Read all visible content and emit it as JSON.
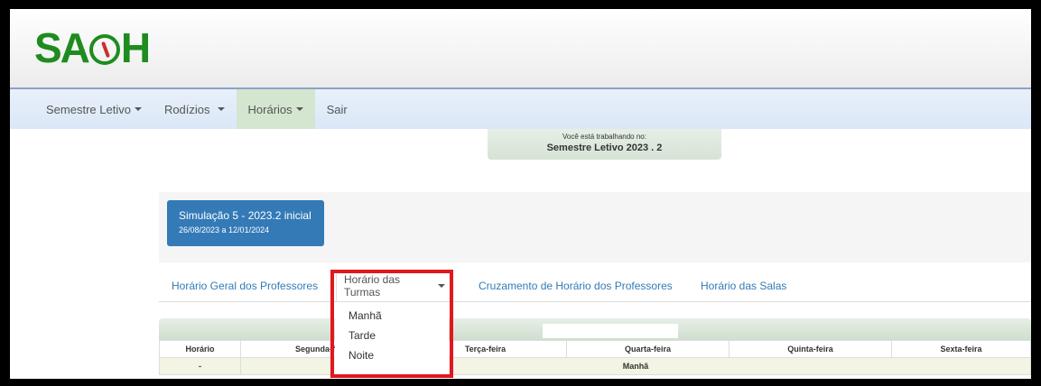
{
  "app": {
    "logo_text_left": "SA",
    "logo_text_right": "H"
  },
  "navbar": {
    "items": [
      {
        "label": "Semestre Letivo",
        "caret": true
      },
      {
        "label": "Rodízios",
        "caret": true
      },
      {
        "label": "Horários",
        "caret": true
      },
      {
        "label": "Sair",
        "caret": false
      }
    ]
  },
  "semester": {
    "label": "Você está trabalhando no:",
    "value": "Semestre Letivo 2023 . 2"
  },
  "simulation": {
    "title": "Simulação 5 - 2023.2 inicial",
    "dates": "26/08/2023 a 12/01/2024"
  },
  "tabs": [
    {
      "label": "Horário Geral dos Professores"
    },
    {
      "label": "Horário das Turmas"
    },
    {
      "label": "Cruzamento de Horário dos Professores"
    },
    {
      "label": "Horário das Salas"
    }
  ],
  "dropdown": {
    "options": [
      "Manhã",
      "Tarde",
      "Noite"
    ]
  },
  "table": {
    "headers": [
      "Horário",
      "Segunda-feira",
      "Terça-feira",
      "Quarta-feira",
      "Quinta-feira",
      "Sexta-feira"
    ],
    "row": {
      "time": "-",
      "period": "Manhã"
    }
  },
  "colors": {
    "brand_green": "#1e8c1e",
    "primary_blue": "#337ab7",
    "highlight_red": "#e0191e"
  }
}
